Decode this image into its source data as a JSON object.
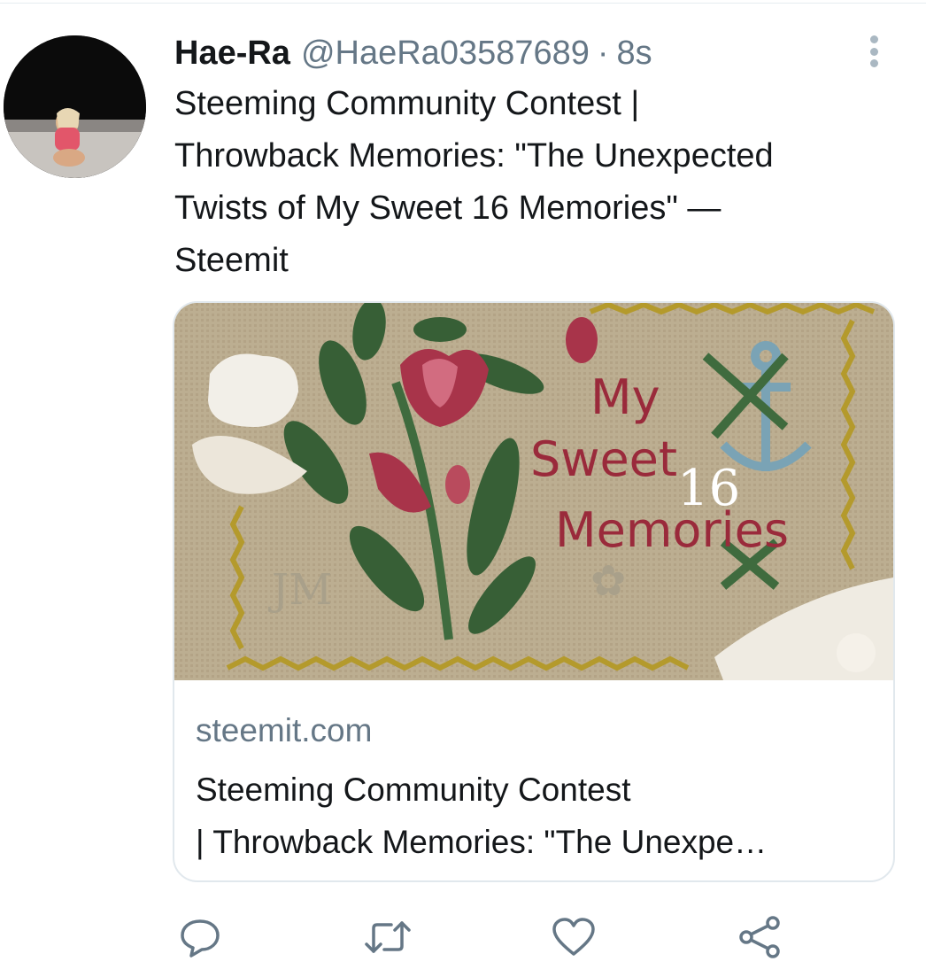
{
  "tweet": {
    "display_name": "Hae-Ra",
    "handle": "@HaeRa03587689",
    "separator": "·",
    "time": "8s",
    "text": "Steeming Community Contest |\nThrowback Memories: \"The Unexpected\nTwists of My Sweet 16 Memories\" —\nSteemit"
  },
  "card": {
    "image_text": {
      "line1": "My",
      "line2": "Sweet",
      "number": "16",
      "line3": "Memories"
    },
    "domain": "steemit.com",
    "title": "Steeming Community Contest\n| Throwback Memories: \"The Unexpe…"
  },
  "actions": {
    "reply_icon": "reply-icon",
    "retweet_icon": "retweet-icon",
    "like_icon": "heart-icon",
    "share_icon": "share-icon"
  },
  "colors": {
    "text_primary": "#14171a",
    "text_secondary": "#657786",
    "border": "#e1e8ed"
  }
}
